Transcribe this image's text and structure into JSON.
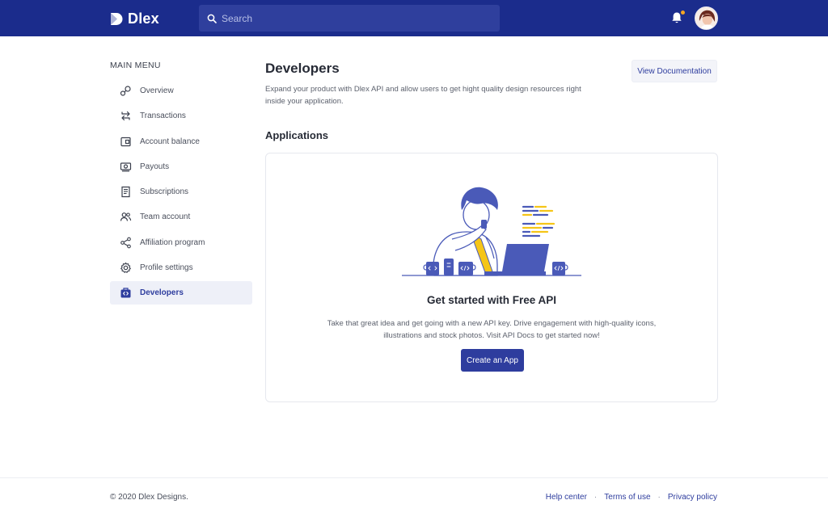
{
  "header": {
    "brand": "Dlex",
    "search_placeholder": "Search",
    "notifications_icon": "bell-icon",
    "notification_dot_color": "#f5a623",
    "accent_color": "#1b2c8c"
  },
  "sidebar": {
    "title": "MAIN MENU",
    "items": [
      {
        "label": "Overview",
        "icon": "overview-icon"
      },
      {
        "label": "Transactions",
        "icon": "transactions-icon"
      },
      {
        "label": "Account balance",
        "icon": "wallet-icon"
      },
      {
        "label": "Payouts",
        "icon": "payouts-icon"
      },
      {
        "label": "Subscriptions",
        "icon": "receipt-icon"
      },
      {
        "label": "Team account",
        "icon": "team-icon"
      },
      {
        "label": "Affiliation program",
        "icon": "share-icon"
      },
      {
        "label": "Profile settings",
        "icon": "gear-icon"
      },
      {
        "label": "Developers",
        "icon": "code-bag-icon",
        "active": true
      }
    ]
  },
  "main": {
    "title": "Developers",
    "description": "Expand your product with Dlex API and allow users to get hight quality design resources right inside your application.",
    "doc_button": "View Documentation",
    "section_title": "Applications",
    "card": {
      "title": "Get started with Free API",
      "description": "Take that great idea and get going with a new API key. Drive engagement with high-quality icons, illustrations and stock photos. Visit API Docs to get started now!",
      "button": "Create an App"
    }
  },
  "footer": {
    "copyright": "© 2020 Dlex Designs.",
    "links": [
      "Help center",
      "Terms of use",
      "Privacy policy"
    ]
  }
}
